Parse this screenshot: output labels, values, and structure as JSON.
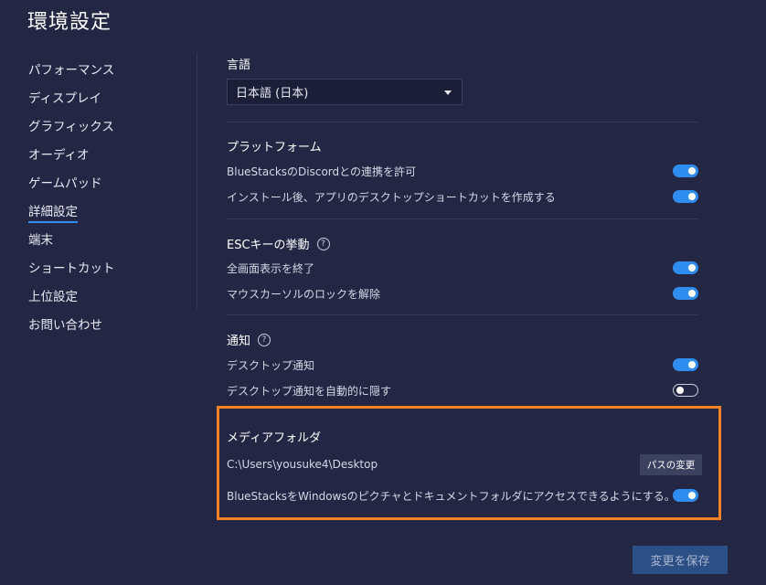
{
  "window": {
    "title": "環境設定"
  },
  "sidebar": {
    "items": [
      {
        "label": "パフォーマンス"
      },
      {
        "label": "ディスプレイ"
      },
      {
        "label": "グラフィックス"
      },
      {
        "label": "オーディオ"
      },
      {
        "label": "ゲームパッド"
      },
      {
        "label": "詳細設定",
        "active": true
      },
      {
        "label": "端末"
      },
      {
        "label": "ショートカット"
      },
      {
        "label": "上位設定"
      },
      {
        "label": "お問い合わせ"
      }
    ]
  },
  "language": {
    "title": "言語",
    "selected": "日本語 (日本)"
  },
  "platform": {
    "title": "プラットフォーム",
    "discord_label": "BlueStacksのDiscordとの連携を許可",
    "discord_on": true,
    "shortcut_label": "インストール後、アプリのデスクトップショートカットを作成する",
    "shortcut_on": true
  },
  "esc": {
    "title": "ESCキーの挙動",
    "help": "?",
    "fullscreen_label": "全画面表示を終了",
    "fullscreen_on": true,
    "cursor_label": "マウスカーソルのロックを解除",
    "cursor_on": true
  },
  "notifications": {
    "title": "通知",
    "help": "?",
    "desktop_label": "デスクトップ通知",
    "desktop_on": true,
    "autohide_label": "デスクトップ通知を自動的に隠す",
    "autohide_on": false
  },
  "media": {
    "title": "メディアフォルダ",
    "path": "C:\\Users\\yousuke4\\Desktop",
    "change_path_label": "パスの変更",
    "access_label": "BlueStacksをWindowsのピクチャとドキュメントフォルダにアクセスできるようにする。",
    "access_on": true
  },
  "footer": {
    "save_label": "変更を保存"
  },
  "colors": {
    "background": "#232744",
    "accent": "#2f8df0",
    "highlight": "#f48226"
  }
}
